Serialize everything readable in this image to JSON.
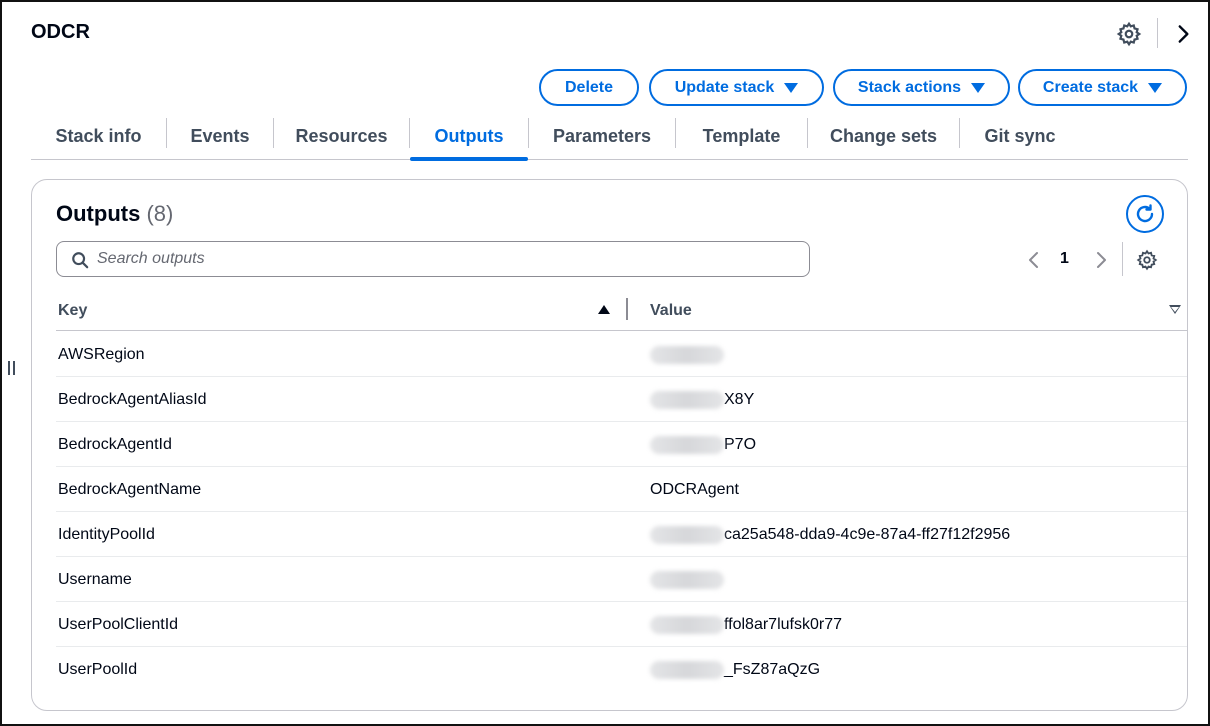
{
  "page": {
    "title": "ODCR"
  },
  "header_icons": {
    "settings": "gear-icon",
    "collapse": "chevron-right-icon"
  },
  "actions": {
    "delete": "Delete",
    "update_stack": "Update stack",
    "stack_actions": "Stack actions",
    "create_stack": "Create stack"
  },
  "tabs": [
    {
      "label": "Stack info"
    },
    {
      "label": "Events"
    },
    {
      "label": "Resources"
    },
    {
      "label": "Outputs",
      "active": true
    },
    {
      "label": "Parameters"
    },
    {
      "label": "Template"
    },
    {
      "label": "Change sets"
    },
    {
      "label": "Git sync"
    }
  ],
  "outputs": {
    "heading": "Outputs",
    "count": "(8)",
    "search_placeholder": "Search outputs",
    "page_number": "1",
    "columns": {
      "key": "Key",
      "value": "Value"
    },
    "rows": [
      {
        "key": "AWSRegion",
        "value": ""
      },
      {
        "key": "BedrockAgentAliasId",
        "value": "X8Y"
      },
      {
        "key": "BedrockAgentId",
        "value": "P7O"
      },
      {
        "key": "BedrockAgentName",
        "value": "ODCRAgent"
      },
      {
        "key": "IdentityPoolId",
        "value": "ca25a548-dda9-4c9e-87a4-ff27f12f2956"
      },
      {
        "key": "Username",
        "value": ""
      },
      {
        "key": "UserPoolClientId",
        "value": "ffol8ar7lufsk0r77"
      },
      {
        "key": "UserPoolId",
        "value": "_FsZ87aQzG"
      }
    ]
  },
  "colors": {
    "accent": "#006ce0",
    "text": "#000716",
    "muted": "#414d5c",
    "border": "#c6c6cd"
  }
}
